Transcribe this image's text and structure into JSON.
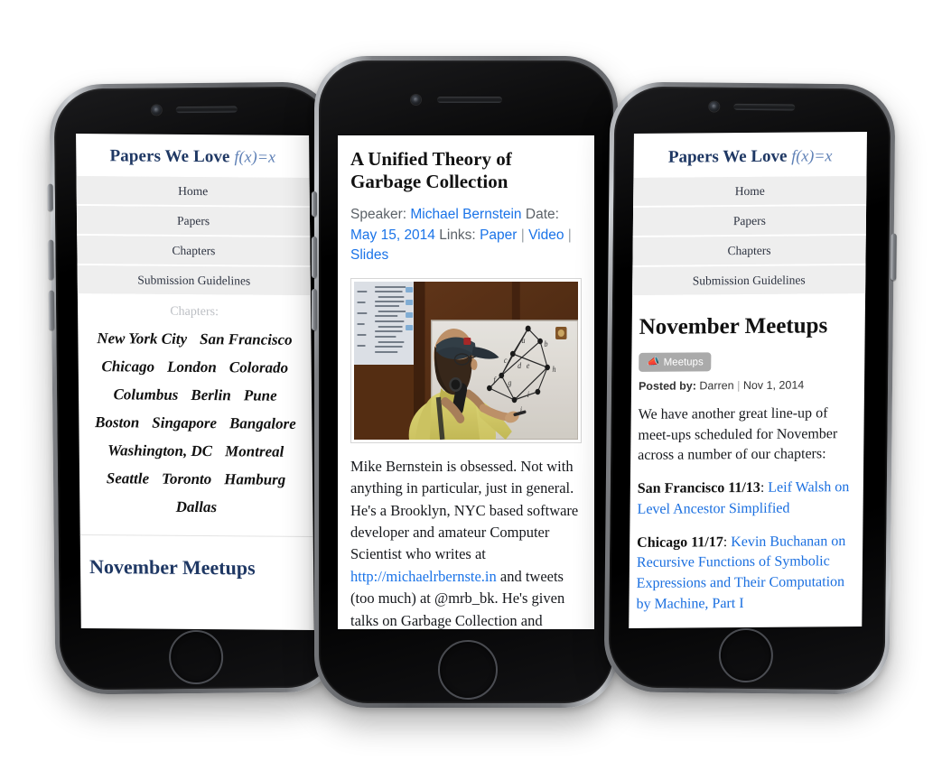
{
  "site": {
    "logo_text": "Papers We Love",
    "logo_formula": "f(x)=x",
    "nav": [
      {
        "label": "Home",
        "name": "nav-home"
      },
      {
        "label": "Papers",
        "name": "nav-papers"
      },
      {
        "label": "Chapters",
        "name": "nav-chapters"
      },
      {
        "label": "Submission Guidelines",
        "name": "nav-submission-guidelines"
      }
    ]
  },
  "left_phone": {
    "chapters_label": "Chapters:",
    "chapters": [
      "New York City",
      "San Francisco",
      "Chicago",
      "London",
      "Colorado",
      "Columbus",
      "Berlin",
      "Pune",
      "Boston",
      "Singapore",
      "Bangalore",
      "Washington, DC",
      "Montreal",
      "Seattle",
      "Toronto",
      "Hamburg",
      "Dallas"
    ],
    "next_post_peek": "November Meetups"
  },
  "center_phone": {
    "post_title": "A Unified Theory of Garbage Collection",
    "meta": {
      "speaker_label": "Speaker:",
      "speaker": "Michael Bernstein",
      "date_label": "Date:",
      "date": "May 15, 2014",
      "links_label": "Links:",
      "links": [
        "Paper",
        "Video",
        "Slides"
      ],
      "separator": "|"
    },
    "figure_alt": "speaker-photo",
    "body_part_1": "Mike Bernstein is obsessed. Not with anything in particular, just in general. He's a Brooklyn, NYC based software developer and amateur Computer Scientist who writes at ",
    "body_link": "http://michaelrbernste.in",
    "body_part_2": " and tweets (too much) at @mrb_bk. He's given talks on Garbage Collection and"
  },
  "right_phone": {
    "post_title": "November Meetups",
    "badge": {
      "icon": "megaphone-icon",
      "label": "Meetups"
    },
    "posted_by_label": "Posted by:",
    "author": "Darren",
    "separator": "|",
    "date": "Nov 1, 2014",
    "intro": "We have another great line-up of meet-ups scheduled for November across a number of our chapters:",
    "meetups": [
      {
        "chapter": "San Francisco",
        "date": "11/13",
        "colon": ":",
        "talk": "Leif Walsh on Level Ancestor Simplified"
      },
      {
        "chapter": "Chicago",
        "date": "11/17",
        "colon": ":",
        "talk": "Kevin Buchanan on Recursive Functions of Symbolic Expressions and Their Computation by Machine, Part I"
      }
    ]
  },
  "colors": {
    "logo": "#1f3864",
    "logo_formula": "#5d7fb5",
    "link": "#1a73e8",
    "nav_bg": "#eeeeee",
    "badge_bg": "#aaaaaa",
    "body_text": "#16181c"
  }
}
